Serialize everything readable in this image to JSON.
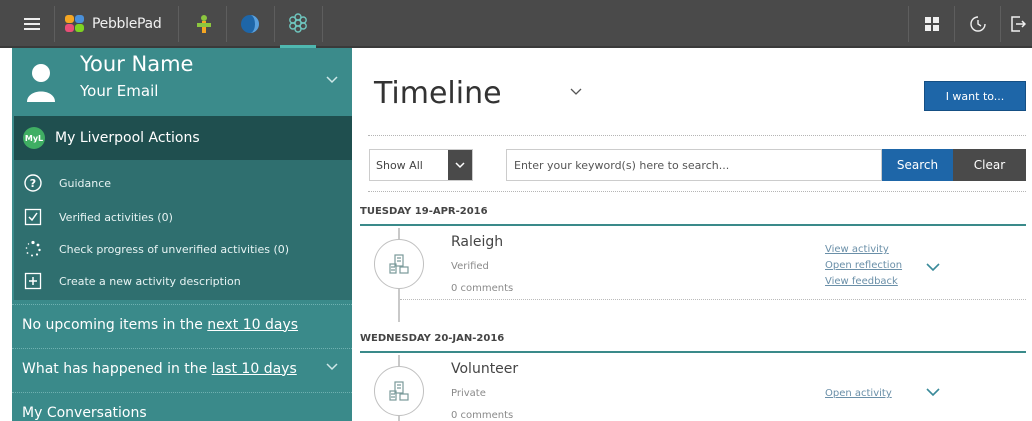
{
  "topbar": {
    "brand": "PebblePad",
    "colors": {
      "bar": "#4a4a4a",
      "active_underline": "#4fb8b0"
    }
  },
  "profile": {
    "name": "Your Name",
    "email": "Your Email"
  },
  "actions": {
    "badge": "MyL",
    "title": "My Liverpool Actions",
    "items": [
      {
        "label": "Guidance",
        "icon": "question-icon"
      },
      {
        "label": "Verified activities (0)",
        "icon": "checkbox-icon"
      },
      {
        "label": "Check progress of unverified activities (0)",
        "icon": "spinner-icon"
      },
      {
        "label": "Create a new activity description",
        "icon": "plus-box-icon"
      }
    ]
  },
  "sidebar_rows": {
    "upcoming_prefix": "No upcoming items in the ",
    "upcoming_link": "next 10 days",
    "happened_prefix": "What has happened in the ",
    "happened_link": "last 10 days",
    "conversations": "My Conversations"
  },
  "main": {
    "title": "Timeline",
    "i_want_label": "I want to...",
    "filter_value": "Show All",
    "search_placeholder": "Enter your keyword(s) here to search...",
    "search_label": "Search",
    "clear_label": "Clear"
  },
  "timeline": [
    {
      "date": "TUESDAY 19-APR-2016",
      "title": "Raleigh",
      "status": "Verified",
      "comments": "0 comments",
      "links": [
        "View activity",
        "Open reflection",
        "View feedback"
      ]
    },
    {
      "date": "WEDNESDAY 20-JAN-2016",
      "title": "Volunteer",
      "status": "Private",
      "comments": "0 comments",
      "links": [
        "Open activity"
      ]
    }
  ]
}
